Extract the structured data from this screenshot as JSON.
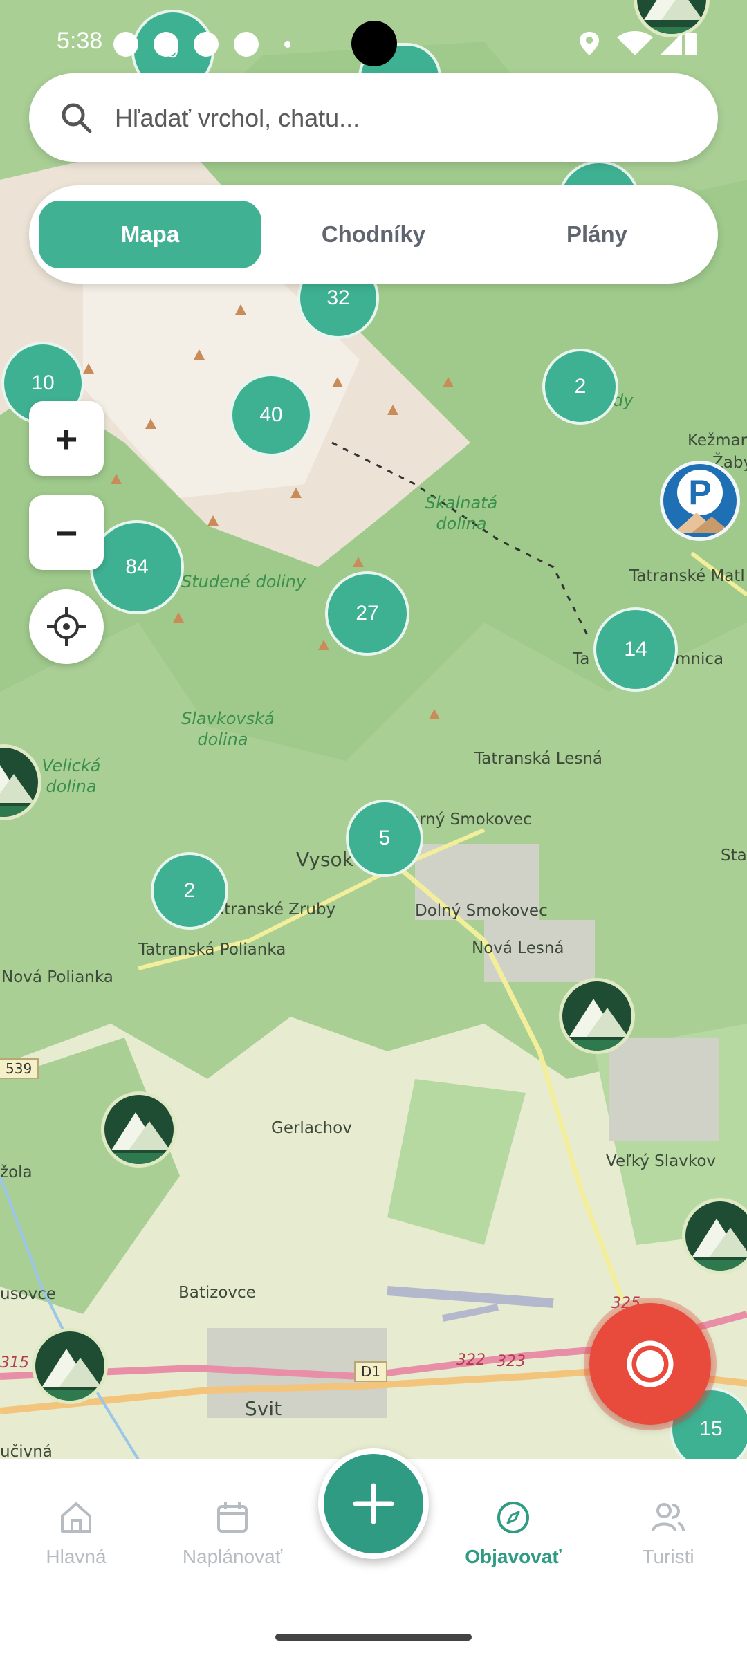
{
  "status_bar": {
    "time": "5:38"
  },
  "search": {
    "placeholder": "Hľadať vrchol, chatu..."
  },
  "tabs": [
    {
      "label": "Mapa",
      "active": true
    },
    {
      "label": "Chodníky",
      "active": false
    },
    {
      "label": "Plány",
      "active": false
    }
  ],
  "map_labels": {
    "studene_doliny": "Studené doliny",
    "skalnata_dolina": "Skalnatá dolina",
    "slavkovska_dolina": "Slavkovská dolina",
    "velicka_dolina": "Velická dolina",
    "tatranska_lesna": "Tatranská Lesná",
    "horny_smokovec": "orný Smokovec",
    "vysoke": "Vysok",
    "tatranske_zruby": "atranské Zruby",
    "dolny_smokovec": "Dolný Smokovec",
    "tatranska_polianka": "Tatranská Polianka",
    "nova_lesna": "Nová Lesná",
    "nova_polianka": "Nová Polianka",
    "gerlachov": "Gerlachov",
    "velky_slavkov": "Veľký Slavkov",
    "batizovce": "Batizovce",
    "svit": "Svit",
    "kezmar": "Kežmar",
    "zaby": "Žaby",
    "tatranske_matl": "Tatranské Matl",
    "tatranska_lomnica_a": "Ta",
    "tatranska_lomnica_b": "mnica",
    "sta": "Sta",
    "dy": "dy",
    "zola": "žola",
    "usovce": "usovce",
    "ucivna": "učivná",
    "road_539": "539",
    "road_d1": "D1",
    "road_322": "322",
    "road_323": "323",
    "road_315": "315",
    "road_325": "325"
  },
  "clusters": [
    {
      "id": "c32",
      "count": "32"
    },
    {
      "id": "c10",
      "count": "10"
    },
    {
      "id": "c40",
      "count": "40"
    },
    {
      "id": "c2a",
      "count": "2"
    },
    {
      "id": "c84",
      "count": "84"
    },
    {
      "id": "c27",
      "count": "27"
    },
    {
      "id": "c14",
      "count": "14"
    },
    {
      "id": "c5",
      "count": "5"
    },
    {
      "id": "c2b",
      "count": "2"
    },
    {
      "id": "c15",
      "count": "15"
    },
    {
      "id": "c9",
      "count": "9"
    }
  ],
  "parking": {
    "letter": "P"
  },
  "map_controls": {
    "zoom_in": "+",
    "zoom_out": "−"
  },
  "nav": [
    {
      "label": "Hlavná",
      "icon": "home-icon",
      "active": false
    },
    {
      "label": "Naplánovať",
      "icon": "calendar-icon",
      "active": false
    },
    {
      "label": "Objavovať",
      "icon": "compass-icon",
      "active": true
    },
    {
      "label": "Turisti",
      "icon": "users-icon",
      "active": false
    }
  ],
  "colors": {
    "accent": "#40b192",
    "record": "#e84b3c",
    "cluster": "#3fb193"
  }
}
